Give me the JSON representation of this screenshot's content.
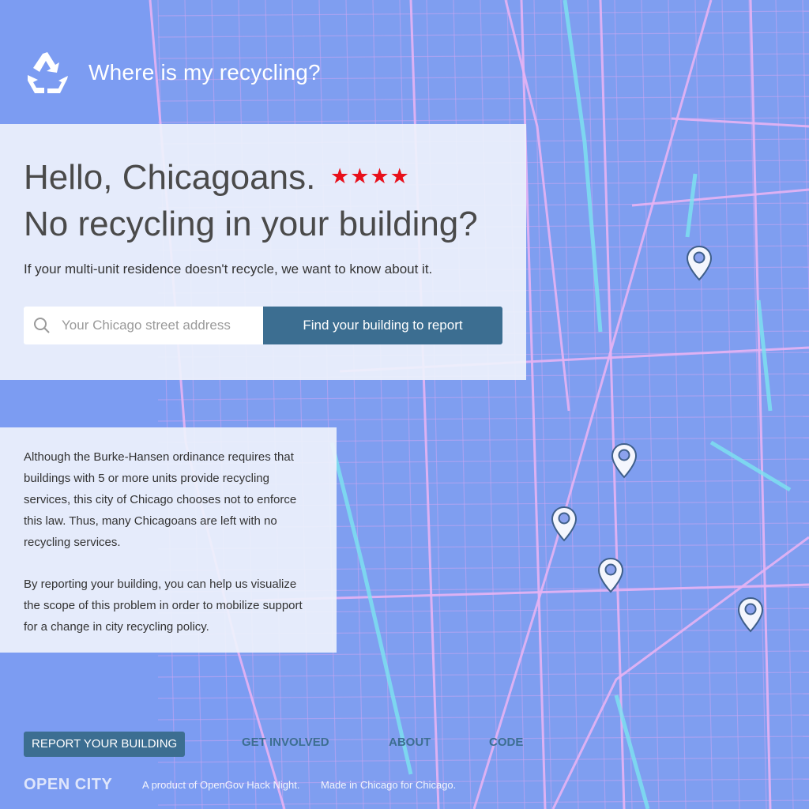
{
  "header": {
    "logo_icon": "recycle-icon",
    "title": "Where is my recycling?"
  },
  "hero": {
    "line1": "Hello, Chicagoans.",
    "stars": "★★★★",
    "star_color": "#e8101b",
    "line2": "No recycling in your building?",
    "lead": "If your multi-unit residence doesn't recycle, we want to know about it.",
    "search": {
      "icon": "search-icon",
      "placeholder": "Your Chicago street address",
      "value": ""
    },
    "find_button": "Find your building to report"
  },
  "info": {
    "paragraph1": "Although the Burke-Hansen ordinance requires that buildings with 5 or more units provide recycling services, this city of Chicago chooses not to enforce this law. Thus, many Chicagoans are left with no recycling services.",
    "paragraph2": "By reporting your building, you can help us visualize the scope of this problem in order to mobilize support for a change in city recycling policy."
  },
  "nav": {
    "report": "REPORT YOUR BUILDING",
    "get_involved": "GET INVOLVED",
    "about": "ABOUT",
    "code": "CODE"
  },
  "footer": {
    "brand": "OPEN CITY",
    "product": "A product of OpenGov Hack Night.",
    "made": "Made in Chicago for Chicago."
  },
  "map": {
    "pin_icon": "map-pin-icon",
    "pin_count": 5
  },
  "colors": {
    "accent": "#3c6e91",
    "map_bg": "#7f9ef0",
    "street": "#d9a8f0",
    "highlight": "#7de3f0"
  }
}
